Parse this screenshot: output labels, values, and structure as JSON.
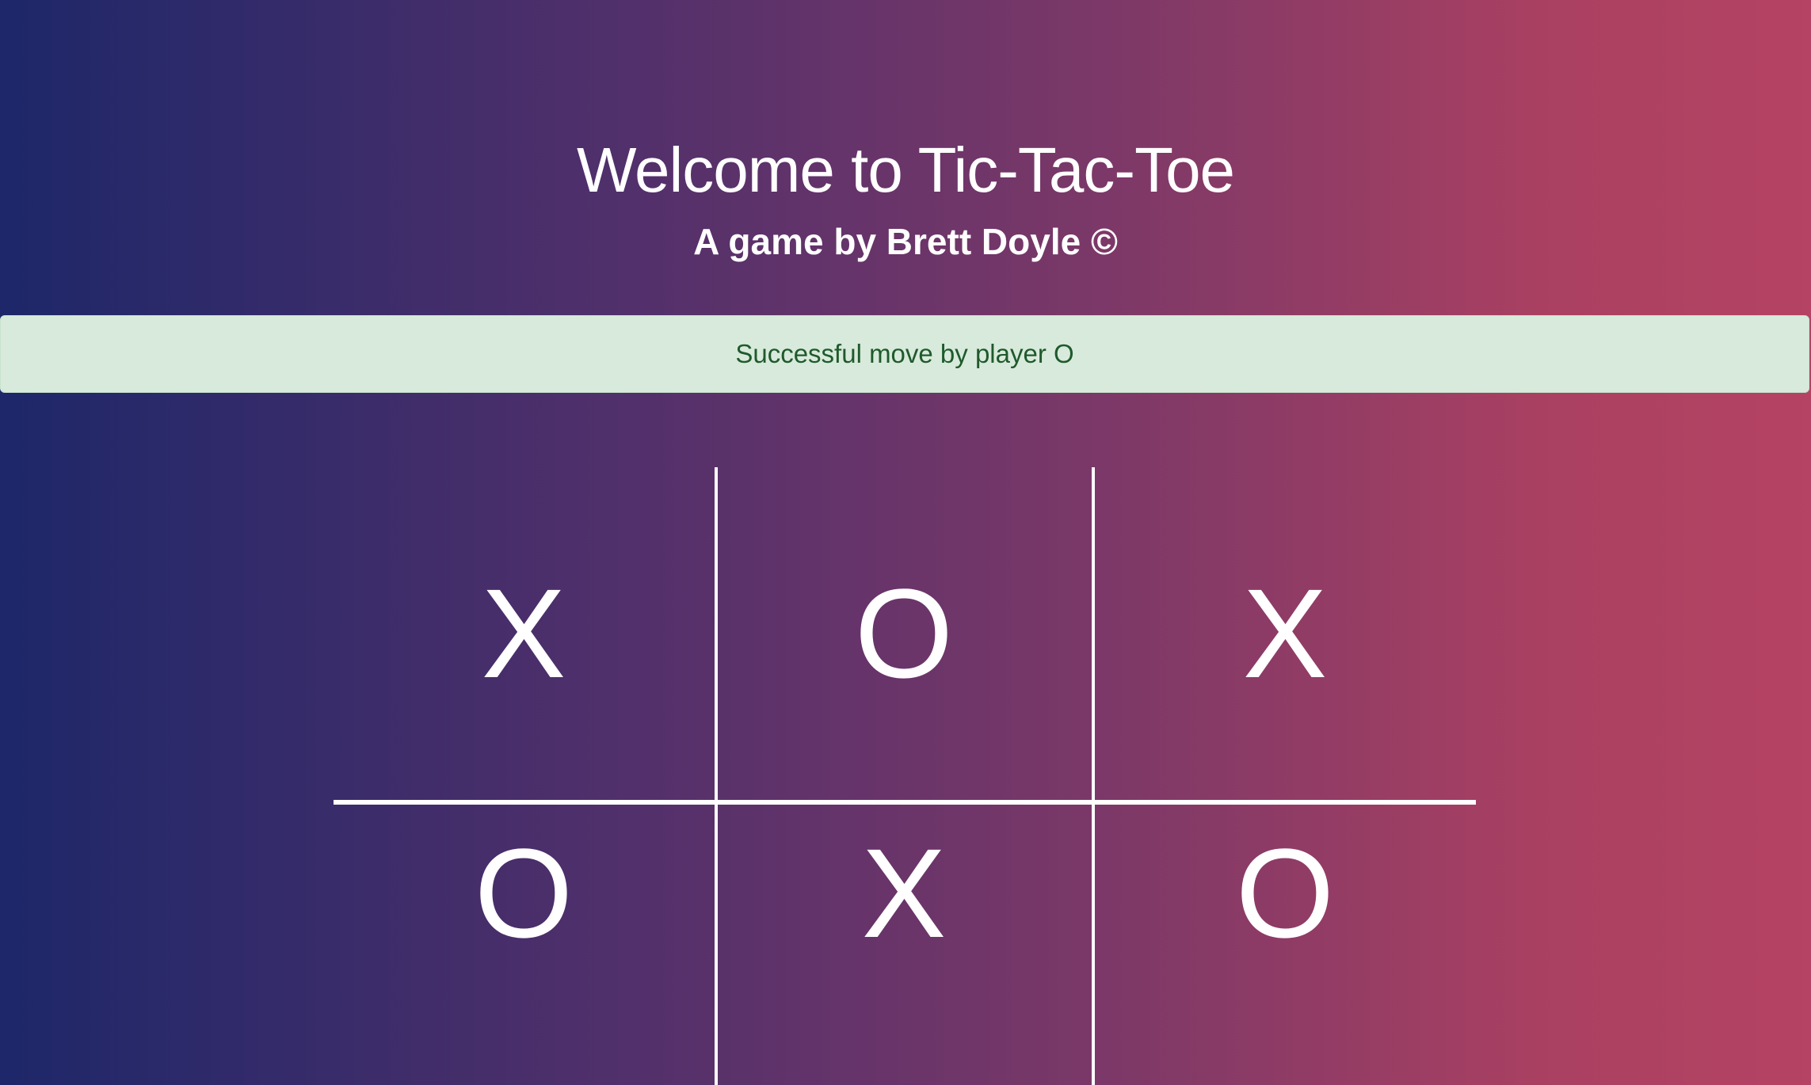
{
  "header": {
    "title": "Welcome to Tic-Tac-Toe",
    "subtitle": "A game by Brett Doyle ©"
  },
  "alert": {
    "message": "Successful move by player O",
    "status": "success",
    "background": "#d8eadb",
    "text_color": "#1f5a2c"
  },
  "board": {
    "cells": [
      "X",
      "O",
      "X",
      "O",
      "X",
      "O"
    ]
  },
  "theme": {
    "gradient_start": "#1d2769",
    "gradient_end": "#b54363"
  }
}
